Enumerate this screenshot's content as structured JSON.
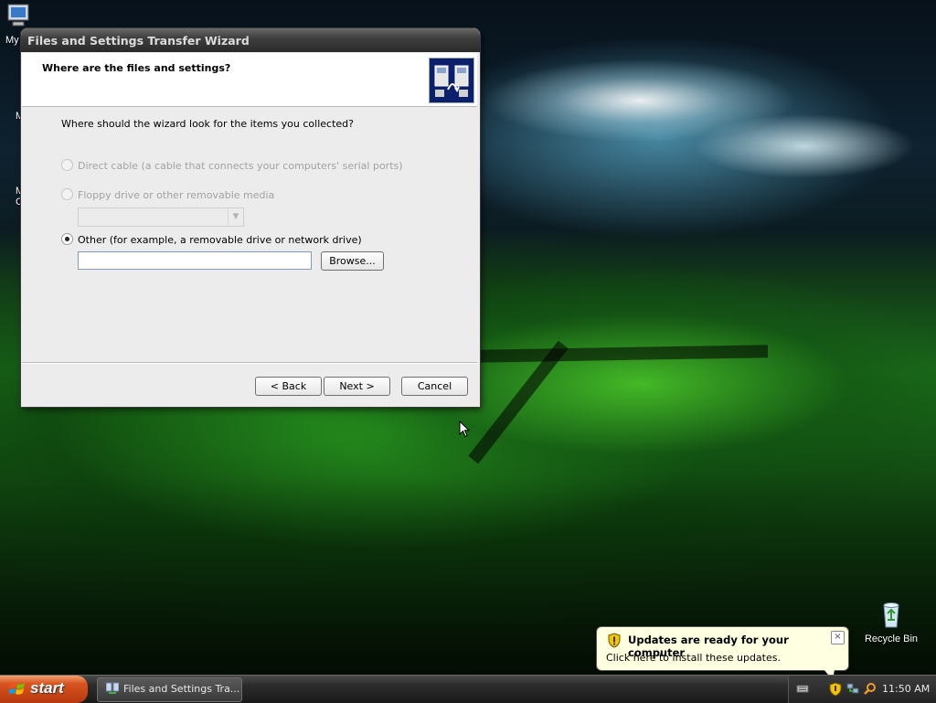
{
  "desktop": {
    "icons": [
      {
        "label": "My",
        "icon": "computer-icon"
      },
      {
        "label": "Recycle Bin",
        "icon": "recycle-bin-icon"
      }
    ],
    "partial_labels": [
      "M",
      "M",
      "C"
    ]
  },
  "wizard": {
    "title": "Files and Settings Transfer Wizard",
    "heading": "Where are the files and settings?",
    "question": "Where should the wizard look for the items you collected?",
    "options": [
      {
        "label": "Direct cable (a cable that connects your computers' serial ports)",
        "enabled": false,
        "checked": false
      },
      {
        "label": "Floppy drive or other removable media",
        "enabled": false,
        "checked": false
      },
      {
        "label": "Other (for example, a removable drive or network drive)",
        "enabled": true,
        "checked": true
      }
    ],
    "floppy_select_value": "",
    "path_value": "",
    "browse_label": "Browse...",
    "back_label": "< Back",
    "next_label": "Next >",
    "cancel_label": "Cancel"
  },
  "balloon": {
    "title": "Updates are ready for your computer",
    "text": "Click here to install these updates.",
    "close": "×"
  },
  "taskbar": {
    "start_label": "start",
    "task_button_label": "Files and Settings Tra...",
    "clock": "11:50 AM",
    "tray_icons": [
      "keyboard-icon",
      "security-shield-icon",
      "network-icon",
      "search-icon"
    ]
  },
  "colors": {
    "start_button": "#d8531e",
    "taskbar": "#2c2c2c",
    "balloon_bg": "#ffffe1",
    "wizard_logo_bg": "#0b1f6b"
  }
}
